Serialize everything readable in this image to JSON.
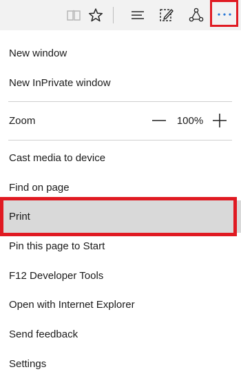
{
  "toolbar": {
    "icons": {
      "reading_view": "book-icon",
      "favorites": "star-icon",
      "hub": "hub-lines-icon",
      "web_note": "pen-note-icon",
      "share": "share-icon",
      "more": "more-dots-icon"
    },
    "more_button_highlight_color": "#e01a22"
  },
  "menu": {
    "new_window": "New window",
    "new_inprivate_window": "New InPrivate window",
    "zoom_label": "Zoom",
    "zoom_value": "100%",
    "cast_media": "Cast media to device",
    "find_on_page": "Find on page",
    "print": "Print",
    "pin_to_start": "Pin this page to Start",
    "f12_tools": "F12 Developer Tools",
    "open_with_ie": "Open with Internet Explorer",
    "send_feedback": "Send feedback",
    "settings": "Settings"
  },
  "colors": {
    "highlight_border": "#e01a22",
    "hover_background": "#d9d9d9",
    "accent_blue": "#2b79d6"
  }
}
